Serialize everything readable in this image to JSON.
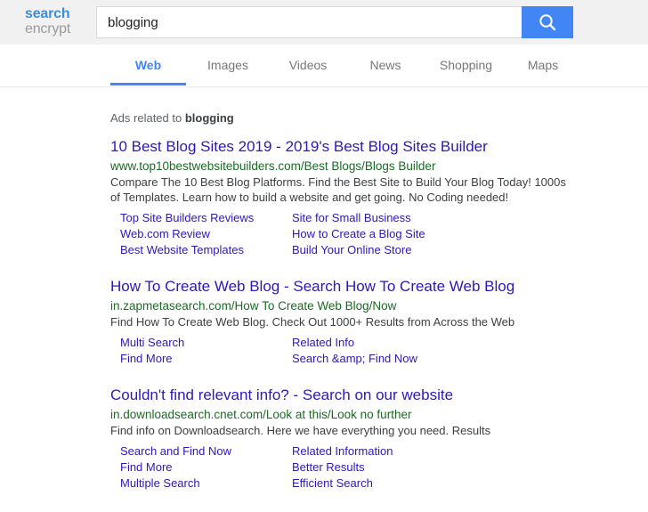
{
  "brand": {
    "name_top": "search",
    "name_bottom": "encrypt",
    "blue": "#3b8fd8",
    "gray": "#9a9a9a"
  },
  "search": {
    "query": "blogging",
    "placeholder": "Search",
    "button_icon": "search-icon",
    "button_color": "#4285f4"
  },
  "nav": {
    "tabs": [
      {
        "label": "Web",
        "active": true
      },
      {
        "label": "Images",
        "active": false
      },
      {
        "label": "Videos",
        "active": false
      },
      {
        "label": "News",
        "active": false
      },
      {
        "label": "Shopping",
        "active": false
      },
      {
        "label": "Maps",
        "active": false
      }
    ],
    "active_color": "#4285f4",
    "inactive_color": "#777777"
  },
  "results": {
    "ads_label_prefix": "Ads related to ",
    "ads_label_term": "blogging",
    "title_color": "#2f18b8",
    "url_color": "#1a6b25",
    "ads": [
      {
        "title": "10 Best Blog Sites 2019 - 2019's Best Blog Sites Builder",
        "url": "www.top10bestwebsitebuilders.com/Best Blogs/Blogs Builder",
        "description": "Compare The 10 Best Blog Platforms. Find the Best Site to Build Your Blog Today! 1000s of Templates. Learn how to build a website and get going. No Coding needed!",
        "sitelinks": [
          "Top Site Builders Reviews",
          "Site for Small Business",
          "Web.com Review",
          "How to Create a Blog Site",
          "Best Website Templates",
          "Build Your Online Store"
        ]
      },
      {
        "title": "How To Create Web Blog - Search How To Create Web Blog",
        "url": "in.zapmetasearch.com/How To Create Web Blog/Now",
        "description": "Find How To Create Web Blog. Check Out 1000+ Results from Across the Web",
        "sitelinks": [
          "Multi Search",
          "Related Info",
          "Find More",
          "Search &amp; Find Now"
        ]
      },
      {
        "title": "Couldn't find relevant info? - Search on our website",
        "url": "in.downloadsearch.cnet.com/Look at this/Look no further",
        "description": "Find info on Downloadsearch. Here we have everything you need. Results",
        "sitelinks": [
          "Search and Find Now",
          "Related Information",
          "Find More",
          "Better Results",
          "Multiple Search",
          "Efficient Search"
        ]
      }
    ]
  }
}
